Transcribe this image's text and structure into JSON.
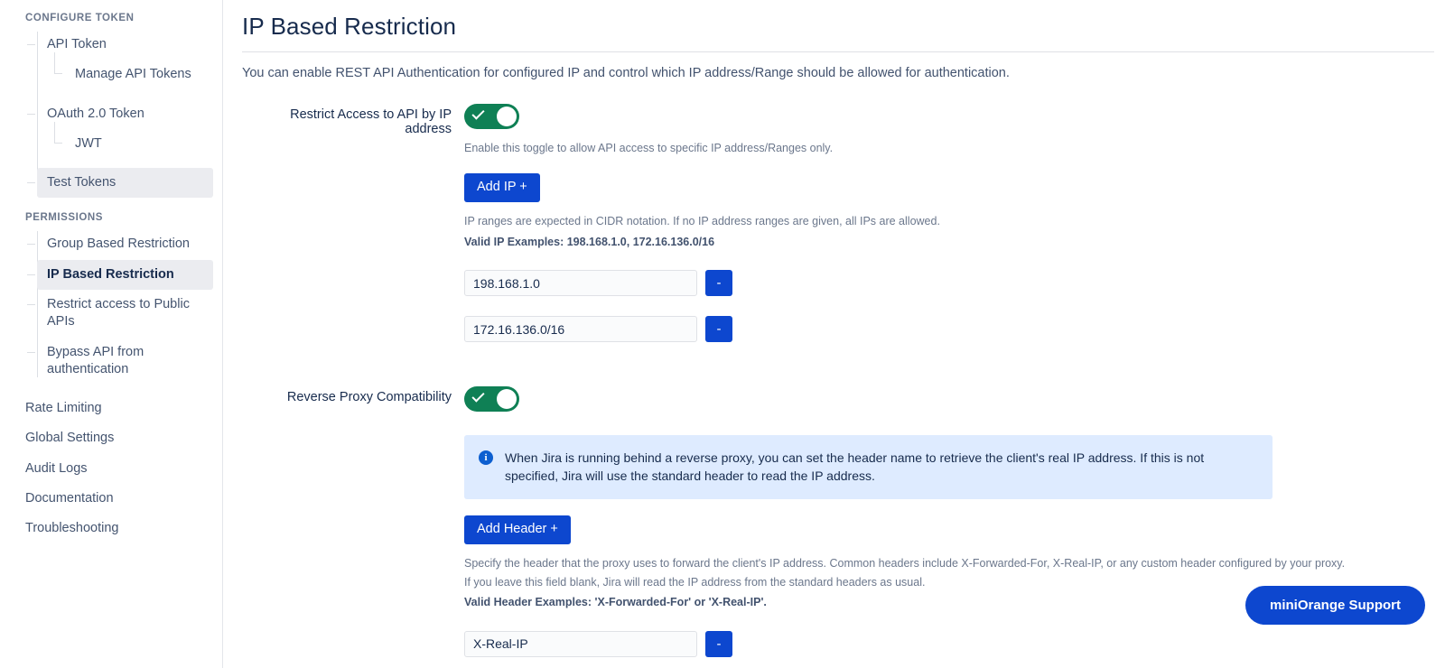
{
  "sidebar": {
    "section1_title": "CONFIGURE TOKEN",
    "section2_title": "PERMISSIONS",
    "items": [
      {
        "label": "API Token"
      },
      {
        "label": "Manage API Tokens"
      },
      {
        "label": "OAuth 2.0 Token"
      },
      {
        "label": "JWT"
      },
      {
        "label": "Test Tokens"
      },
      {
        "label": "Group Based Restriction"
      },
      {
        "label": "IP Based Restriction"
      },
      {
        "label": "Restrict access to Public APIs"
      },
      {
        "label": "Bypass API from authentication"
      },
      {
        "label": "Rate Limiting"
      },
      {
        "label": "Global Settings"
      },
      {
        "label": "Audit Logs"
      },
      {
        "label": "Documentation"
      },
      {
        "label": "Troubleshooting"
      }
    ]
  },
  "page": {
    "title": "IP Based Restriction",
    "description": "You can enable REST API Authentication for configured IP and control which IP address/Range should be allowed for authentication."
  },
  "ip_section": {
    "toggle_label": "Restrict Access to API by IP address",
    "toggle_state": "on",
    "toggle_helper": "Enable this toggle to allow API access to specific IP address/Ranges only.",
    "add_button": "Add IP +",
    "cidr_helper": "IP ranges are expected in CIDR notation. If no IP address ranges are given, all IPs are allowed.",
    "examples": "Valid IP Examples: 198.168.1.0, 172.16.136.0/16",
    "remove_label": "-",
    "entries": [
      {
        "value": "198.168.1.0"
      },
      {
        "value": "172.16.136.0/16"
      }
    ]
  },
  "proxy_section": {
    "toggle_label": "Reverse Proxy Compatibility",
    "toggle_state": "on",
    "info_text": "When Jira is running behind a reverse proxy, you can set the header name to retrieve the client's real IP address. If this is not specified, Jira will use the standard header to read the IP address.",
    "add_button": "Add Header +",
    "helper_line1": "Specify the header that the proxy uses to forward the client's IP address. Common headers include X-Forwarded-For, X-Real-IP, or any custom header configured by your proxy.",
    "helper_line2": "If you leave this field blank, Jira will read the IP address from the standard headers as usual.",
    "examples": "Valid Header Examples: 'X-Forwarded-For' or 'X-Real-IP'.",
    "remove_label": "-",
    "entries": [
      {
        "value": "X-Real-IP"
      }
    ]
  },
  "support": {
    "label": "miniOrange Support"
  },
  "colors": {
    "accent_blue": "#0d47cf",
    "toggle_green": "#0f8055",
    "info_bg": "#deebff",
    "active_bg": "#ebecf0"
  }
}
